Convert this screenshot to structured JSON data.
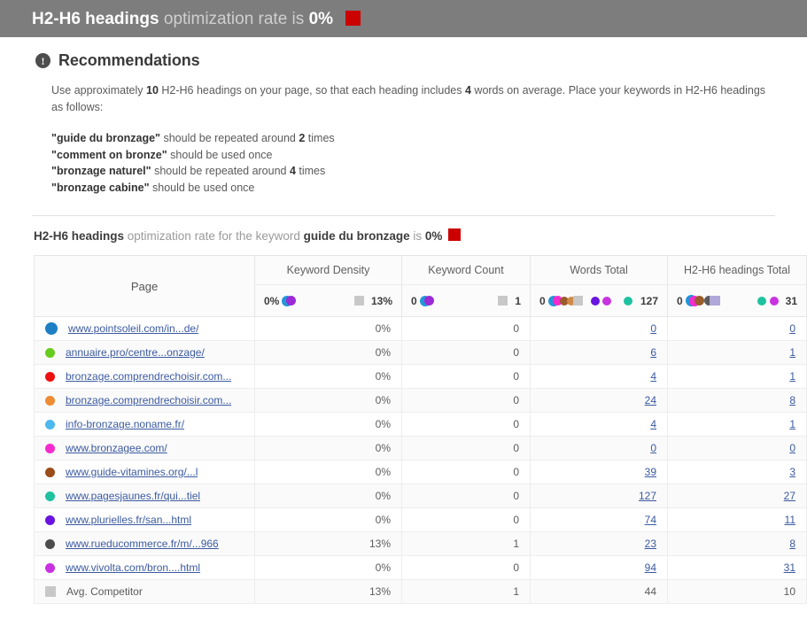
{
  "topbar": {
    "bold_label": "H2-H6 headings",
    "muted_label": "optimization rate is",
    "value": "0%",
    "swatch_color": "#cc0000"
  },
  "recommendations": {
    "icon": "info-circle-icon",
    "title": "Recommendations",
    "paragraph_1": "Use approximately ",
    "headings_count": "10",
    "paragraph_2": " H2-H6 headings on your page, so that each heading includes ",
    "words_avg": "4",
    "paragraph_3": " words on average. Place your keywords in H2-H6 headings as follows:",
    "keyword_lines": [
      {
        "quote_open": "\"",
        "keyword": "guide du bronzage",
        "quote_close": "\"",
        "text_before": " should be repeated around ",
        "count": "2",
        "text_after": " times"
      },
      {
        "quote_open": "\"",
        "keyword": "comment on bronze",
        "quote_close": "\"",
        "text_before": " should be used once",
        "count": "",
        "text_after": ""
      },
      {
        "quote_open": "\"",
        "keyword": "bronzage naturel",
        "quote_close": "\"",
        "text_before": " should be repeated around ",
        "count": "4",
        "text_after": " times"
      },
      {
        "quote_open": "\"",
        "keyword": "bronzage cabine",
        "quote_close": "\"",
        "text_before": " should be used once",
        "count": "",
        "text_after": ""
      }
    ]
  },
  "subtitle": {
    "bold_metric": "H2-H6 headings",
    "muted_1": " optimization rate for the keyword ",
    "bold_keyword": "guide du bronzage",
    "muted_2": " is ",
    "value": "0%",
    "swatch_color": "#cc0000"
  },
  "table": {
    "columns": {
      "page": "Page",
      "keyword_density": "Keyword Density",
      "keyword_count": "Keyword Count",
      "words_total": "Words Total",
      "headings_total": "H2-H6 headings Total"
    },
    "scales": {
      "keyword_density": {
        "min": "0%",
        "max": "13%",
        "min_dots": [
          "#9b2bd6",
          "#2196d8"
        ],
        "max_marker": "#c8c8c8"
      },
      "keyword_count": {
        "min": "0",
        "max": "1",
        "min_dots": [
          "#9b2bd6",
          "#2196d8"
        ],
        "max_marker": "#c8c8c8"
      },
      "words_total": {
        "min": "0",
        "max": "127",
        "min_dots": [
          "#f52bd0",
          "#2196d8",
          "#9a5c2b",
          "#d08a48",
          "#c8c8c8"
        ],
        "mid_dots": [
          "#6a14e0",
          "#c832e0"
        ],
        "max_dots": [
          "#1fc2a0"
        ]
      },
      "headings_total": {
        "min": "0",
        "max": "31",
        "min_dots": [
          "#f52bd0",
          "#9a5c2b",
          "#2196d8",
          "#5a5a5a",
          "#b0a8d8"
        ],
        "max_dots": [
          "#1fc2a0",
          "#c832e0"
        ]
      }
    },
    "rows": [
      {
        "dot": "#1e7fc4",
        "dot_size": "big",
        "marker": "dot",
        "url": "www.pointsoleil.com/in...de/",
        "keyword_density": "0%",
        "keyword_count": "0",
        "words_total": "0",
        "headings_total": "0",
        "linked": true
      },
      {
        "dot": "#66cc1e",
        "dot_size": "small",
        "marker": "dot",
        "url": "annuaire.pro/centre...onzage/",
        "keyword_density": "0%",
        "keyword_count": "0",
        "words_total": "6",
        "headings_total": "1",
        "linked": true
      },
      {
        "dot": "#ee1111",
        "dot_size": "small",
        "marker": "dot",
        "url": "bronzage.comprendrechoisir.com...",
        "keyword_density": "0%",
        "keyword_count": "0",
        "words_total": "4",
        "headings_total": "1",
        "linked": true
      },
      {
        "dot": "#ef8b33",
        "dot_size": "small",
        "marker": "dot",
        "url": "bronzage.comprendrechoisir.com...",
        "keyword_density": "0%",
        "keyword_count": "0",
        "words_total": "24",
        "headings_total": "8",
        "linked": true
      },
      {
        "dot": "#4cb8ee",
        "dot_size": "small",
        "marker": "dot",
        "url": "info-bronzage.noname.fr/",
        "keyword_density": "0%",
        "keyword_count": "0",
        "words_total": "4",
        "headings_total": "1",
        "linked": true
      },
      {
        "dot": "#f52bd0",
        "dot_size": "small",
        "marker": "dot",
        "url": "www.bronzagee.com/",
        "keyword_density": "0%",
        "keyword_count": "0",
        "words_total": "0",
        "headings_total": "0",
        "linked": true
      },
      {
        "dot": "#9a4d18",
        "dot_size": "small",
        "marker": "dot",
        "url": "www.guide-vitamines.org/...l",
        "keyword_density": "0%",
        "keyword_count": "0",
        "words_total": "39",
        "headings_total": "3",
        "linked": true
      },
      {
        "dot": "#1fc2a0",
        "dot_size": "small",
        "marker": "dot",
        "url": "www.pagesjaunes.fr/qui...tiel",
        "keyword_density": "0%",
        "keyword_count": "0",
        "words_total": "127",
        "headings_total": "27",
        "linked": true
      },
      {
        "dot": "#6a14e0",
        "dot_size": "small",
        "marker": "dot",
        "url": "www.plurielles.fr/san...html",
        "keyword_density": "0%",
        "keyword_count": "0",
        "words_total": "74",
        "headings_total": "11",
        "linked": true
      },
      {
        "dot": "#4d4d4d",
        "dot_size": "small",
        "marker": "dot",
        "url": "www.rueducommerce.fr/m/...966",
        "keyword_density": "13%",
        "keyword_count": "1",
        "words_total": "23",
        "headings_total": "8",
        "linked": true
      },
      {
        "dot": "#c832e0",
        "dot_size": "small",
        "marker": "dot",
        "url": "www.vivolta.com/bron....html",
        "keyword_density": "0%",
        "keyword_count": "0",
        "words_total": "94",
        "headings_total": "31",
        "linked": true
      },
      {
        "dot": "#c8c8c8",
        "dot_size": "small",
        "marker": "square",
        "url": "Avg. Competitor",
        "keyword_density": "13%",
        "keyword_count": "1",
        "words_total": "44",
        "headings_total": "10",
        "linked": false
      }
    ]
  }
}
